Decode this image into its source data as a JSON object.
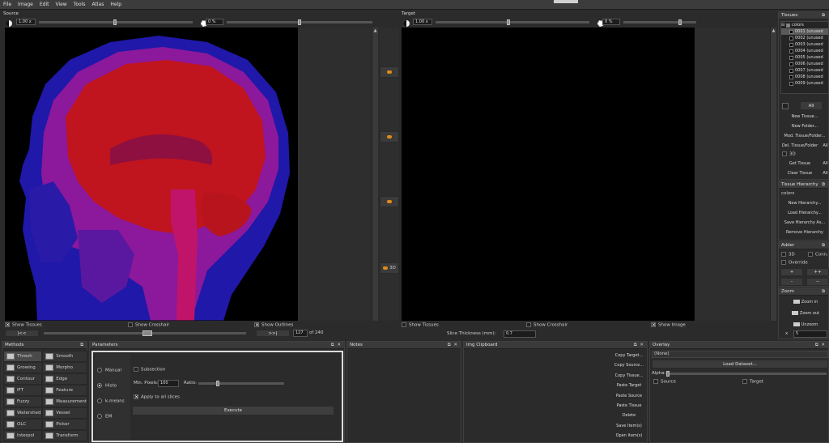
{
  "menu": [
    "File",
    "Image",
    "Edit",
    "View",
    "Tools",
    "Atlas",
    "Help"
  ],
  "source": {
    "title": "Source",
    "zoom": "1.00",
    "zoom_unit": "x",
    "contrast": "0",
    "contrast_unit": "%",
    "show_tissues": "Show Tissues",
    "show_crosshair": "Show Crosshair",
    "show_outlines": "Show Outlines",
    "first_btn": "|<<",
    "last_btn": ">>|",
    "slice": "127",
    "slice_total": "of 240"
  },
  "target": {
    "title": "Target",
    "zoom": "1.00",
    "zoom_unit": "x",
    "contrast": "0",
    "contrast_unit": "%",
    "show_tissues": "Show Tissues",
    "show_crosshair": "Show Crosshair",
    "show_image": "Show Image",
    "slice_thickness_label": "Slice Thickness (mm):",
    "slice_thickness": "0.7"
  },
  "middle": {
    "btn_3d": "3D"
  },
  "methods": {
    "title": "Methods",
    "items": [
      [
        "Thresh",
        "Smooth"
      ],
      [
        "Growing",
        "Morpho"
      ],
      [
        "Contour",
        "Edge"
      ],
      [
        "IFT",
        "Feature"
      ],
      [
        "Fuzzy",
        "Measurement"
      ],
      [
        "Watershed",
        "Vessel"
      ],
      [
        "OLC",
        "Picker"
      ],
      [
        "Interpol",
        "Transform"
      ]
    ],
    "selected": "Thresh"
  },
  "parameters": {
    "title": "Parameters",
    "modes": [
      "Manual",
      "Histo",
      "k-means",
      "EM"
    ],
    "selected_mode": "Histo",
    "subsection": "Subsection",
    "min_pixels_label": "Min. Pixels:",
    "min_pixels": "100",
    "ratio_label": "Ratio:",
    "apply_all": "Apply to all slices",
    "execute": "Execute"
  },
  "notes": {
    "title": "Notes"
  },
  "clipboard": {
    "title": "Img Clipboard",
    "buttons": [
      "Copy Target...",
      "Copy Source...",
      "Copy Tissue...",
      "Paste Target",
      "Paste Source",
      "Paste Tissue",
      "Delete",
      "Save Item(s)",
      "Open Item(s)"
    ]
  },
  "overlay": {
    "title": "Overlay",
    "value": "(None)",
    "load_dataset": "Load Dataset...",
    "alpha_label": "Alpha:",
    "source": "Source",
    "target": "Target"
  },
  "tissues": {
    "title": "Tissues",
    "root": "colors",
    "items": [
      "0001 (unused",
      "0002 (unused",
      "0003 (unused",
      "0004 (unused",
      "0005 (unused",
      "0006 (unused",
      "0007 (unused",
      "0008 (unused",
      "0009 (unused"
    ],
    "all_btn": "All",
    "new_tissue": "New Tissue...",
    "new_folder": "New Folder...",
    "mod_tissue": "Mod. Tissue/Folder...",
    "del_tissue": "Del. Tissue/Folder",
    "all_short": "All",
    "three_d": "3D",
    "get_tissue": "Get Tissue",
    "clear_tissue": "Clear Tissue"
  },
  "hierarchy": {
    "title": "Tissue Hierarchy",
    "value": "colors",
    "new": "New Hierarchy...",
    "load": "Load Hierarchy...",
    "save": "Save Hierarchy As...",
    "remove": "Remove Hierarchy"
  },
  "adder": {
    "title": "Adder",
    "three_d": "3D",
    "conn": "Conn.",
    "override": "Override",
    "plus": "+",
    "plusplus": "++",
    "minus": "-",
    "minusminus": "--"
  },
  "zoom": {
    "title": "Zoom",
    "zoom_in": "Zoom in",
    "zoom_out": "Zoom out",
    "unzoom": "Unzoom",
    "x_label": "x",
    "value": "5"
  }
}
